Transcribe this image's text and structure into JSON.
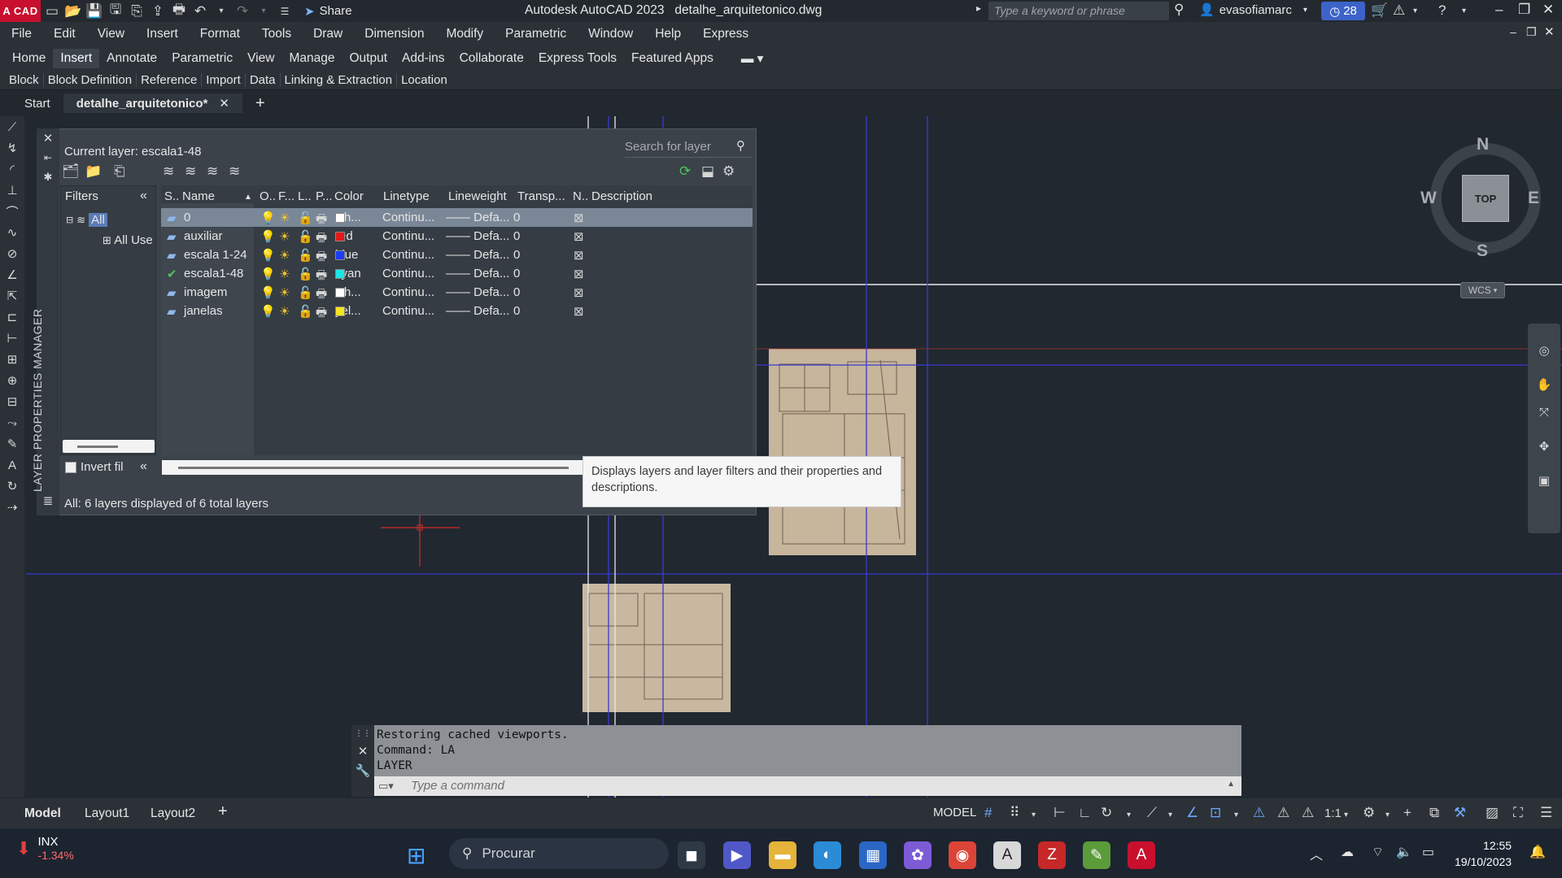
{
  "titlebar": {
    "logo": "A CAD",
    "share": "Share",
    "title": "Autodesk AutoCAD 2023   detalhe_arquitetonico.dwg",
    "search_placeholder": "Type a keyword or phrase",
    "user": "evasofiamarc",
    "badge_count": "28"
  },
  "menu": [
    "File",
    "Edit",
    "View",
    "Insert",
    "Format",
    "Tools",
    "Draw",
    "Dimension",
    "Modify",
    "Parametric",
    "Window",
    "Help",
    "Express"
  ],
  "ribbon_tabs": [
    "Home",
    "Insert",
    "Annotate",
    "Parametric",
    "View",
    "Manage",
    "Output",
    "Add-ins",
    "Collaborate",
    "Express Tools",
    "Featured Apps"
  ],
  "ribbon_active": "Insert",
  "ribbon_panels": [
    "Block",
    "Block Definition",
    "Reference",
    "Import",
    "Data",
    "Linking & Extraction",
    "Location"
  ],
  "file_tabs": {
    "start": "Start",
    "active": "detalhe_arquitetonico*"
  },
  "layer_manager": {
    "side_label": "LAYER PROPERTIES MANAGER",
    "current_layer": "Current layer: escala1-48",
    "search_placeholder": "Search for layer",
    "filters_label": "Filters",
    "tree_all": "All",
    "tree_all_used": "All Use",
    "invert_filter": "Invert fil",
    "columns": [
      "S..",
      "Name",
      "O..",
      "F...",
      "L..",
      "P...",
      "Color",
      "Linetype",
      "Lineweight",
      "Transp...",
      "N..",
      "Description"
    ],
    "layers": [
      {
        "name": "0",
        "color_name": "wh...",
        "color": "#ffffff",
        "linetype": "Continu...",
        "lineweight": "Defa...",
        "transparency": "0",
        "current": false,
        "selected": true
      },
      {
        "name": "auxiliar",
        "color_name": "red",
        "color": "#e11919",
        "linetype": "Continu...",
        "lineweight": "Defa...",
        "transparency": "0",
        "current": false,
        "selected": false
      },
      {
        "name": "escala 1-24",
        "color_name": "blue",
        "color": "#1d3bff",
        "linetype": "Continu...",
        "lineweight": "Defa...",
        "transparency": "0",
        "current": false,
        "selected": false
      },
      {
        "name": "escala1-48",
        "color_name": "cyan",
        "color": "#19e6e6",
        "linetype": "Continu...",
        "lineweight": "Defa...",
        "transparency": "0",
        "current": true,
        "selected": false
      },
      {
        "name": "imagem",
        "color_name": "wh...",
        "color": "#ffffff",
        "linetype": "Continu...",
        "lineweight": "Defa...",
        "transparency": "0",
        "current": false,
        "selected": false
      },
      {
        "name": "janelas",
        "color_name": "yel...",
        "color": "#f5e51c",
        "linetype": "Continu...",
        "lineweight": "Defa...",
        "transparency": "0",
        "current": false,
        "selected": false
      }
    ],
    "status": "All: 6 layers displayed of 6 total layers",
    "tooltip": "Displays layers and layer filters and their properties and descriptions."
  },
  "viewcube": {
    "top": "TOP",
    "n": "N",
    "s": "S",
    "e": "E",
    "w": "W",
    "wcs": "WCS"
  },
  "command": {
    "history": [
      "Restoring cached viewports.",
      "Command: LA",
      "LAYER"
    ],
    "placeholder": "Type a command"
  },
  "layout_tabs": [
    "Model",
    "Layout1",
    "Layout2"
  ],
  "status": {
    "model": "MODEL",
    "scale": "1:1"
  },
  "taskbar": {
    "stock_name": "INX",
    "stock_change": "-1.34%",
    "search": "Procurar",
    "time": "12:55",
    "date": "19/10/2023"
  }
}
